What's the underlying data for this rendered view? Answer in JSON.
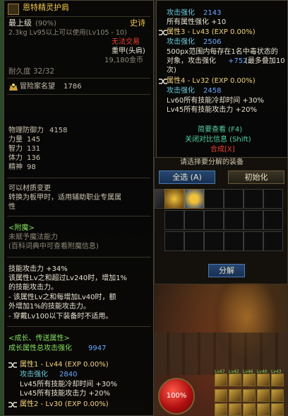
{
  "item": {
    "name": "恩特精灵护肩",
    "grade_label": "最上级",
    "grade_pct": "(90%)",
    "rarity": "史诗",
    "weight_req": "2.3kg  Lv95以上可以使用(Lv105 - 10)",
    "trade": "无法交易",
    "slot": "重甲(头肩)",
    "price": "19,180金币",
    "durability": "耐久度 32/32",
    "fame_label": "冒险家名望",
    "fame_value": "1786",
    "stats": [
      {
        "label": "物理防御力",
        "value": "4158"
      },
      {
        "label": "力量",
        "value": "145"
      },
      {
        "label": "智力",
        "value": "131"
      },
      {
        "label": "体力",
        "value": "136"
      },
      {
        "label": "精神",
        "value": "98"
      }
    ],
    "material_note_1": "可以材质变更",
    "material_note_2": "转换为板甲时，适用辅助职业专属属",
    "material_note_3": "性",
    "enchant_header": "<附魔>",
    "enchant_1": "未赋予魔法能力",
    "enchant_2": "(百科词典中可查看附魔信息)",
    "effects": [
      "技能攻击力 +34%",
      "该属性Lv之和超过Lv240时，增加1%",
      "的技能攻击力。",
      "- 该属性Lv之和每增加Lv40时，额",
      "外增加1%的技能攻击力。",
      "- 穿戴Lv100以下装备时不适用。"
    ],
    "growth_header": "<成长、传送属性>",
    "growth_total_label": "成长属性总攻击强化",
    "growth_total_value": "9947",
    "attr1_title": "属性1 - Lv44 (EXP 0.00%)",
    "attr1_atk_label": "攻击强化",
    "attr1_atk_value": "2840",
    "attr1_l1": "Lv45所有技能冷却时间 +30%",
    "attr1_l2": "Lv45所有技能攻击力 +20%",
    "attr2_title": "属性2 - Lv30 (EXP 0.00%)"
  },
  "compare": {
    "l1_label": "攻击强化",
    "l1_value": "2143",
    "l2": "所有属性强化 +10",
    "attr3_title": "属性3 - Lv43 (EXP 0.00%)",
    "attr3_atk_label": "攻击强化",
    "attr3_atk_value": "2506",
    "attr3_l1": "500px范围内每存在1名中毒状态的",
    "attr3_l2a": "对象，攻击强化",
    "attr3_l2b": "+752",
    "attr3_l2c": "(最多叠加10",
    "attr3_l3": "次)",
    "attr4_title": "属性4 - Lv32 (EXP 0.00%)",
    "attr4_atk_label": "攻击强化",
    "attr4_atk_value": "2458",
    "attr4_l1": "Lv60所有技能冷却时间 +30%",
    "attr4_l2": "Lv45所有技能攻击力 +20%",
    "simple_view": "简要查看 (F4)",
    "close_compare": "关闭对比信息 (Shift)",
    "synthesize": "合成[X]"
  },
  "inventory": {
    "partial_text": "请选择要分解的装备",
    "select_all": "全选 (A)",
    "initialize": "初始化",
    "disassemble": "分解"
  },
  "hud": {
    "hp": "100%",
    "skill_levels": [
      "Lv47",
      "Lv42",
      "Lv46",
      "Lv40",
      "Lv43"
    ]
  },
  "colors": {
    "rarity_epic": "#f0c64a",
    "stat_blue": "#6aa8ff",
    "growth_green": "#82e05c",
    "warning_red": "#e8402a"
  }
}
